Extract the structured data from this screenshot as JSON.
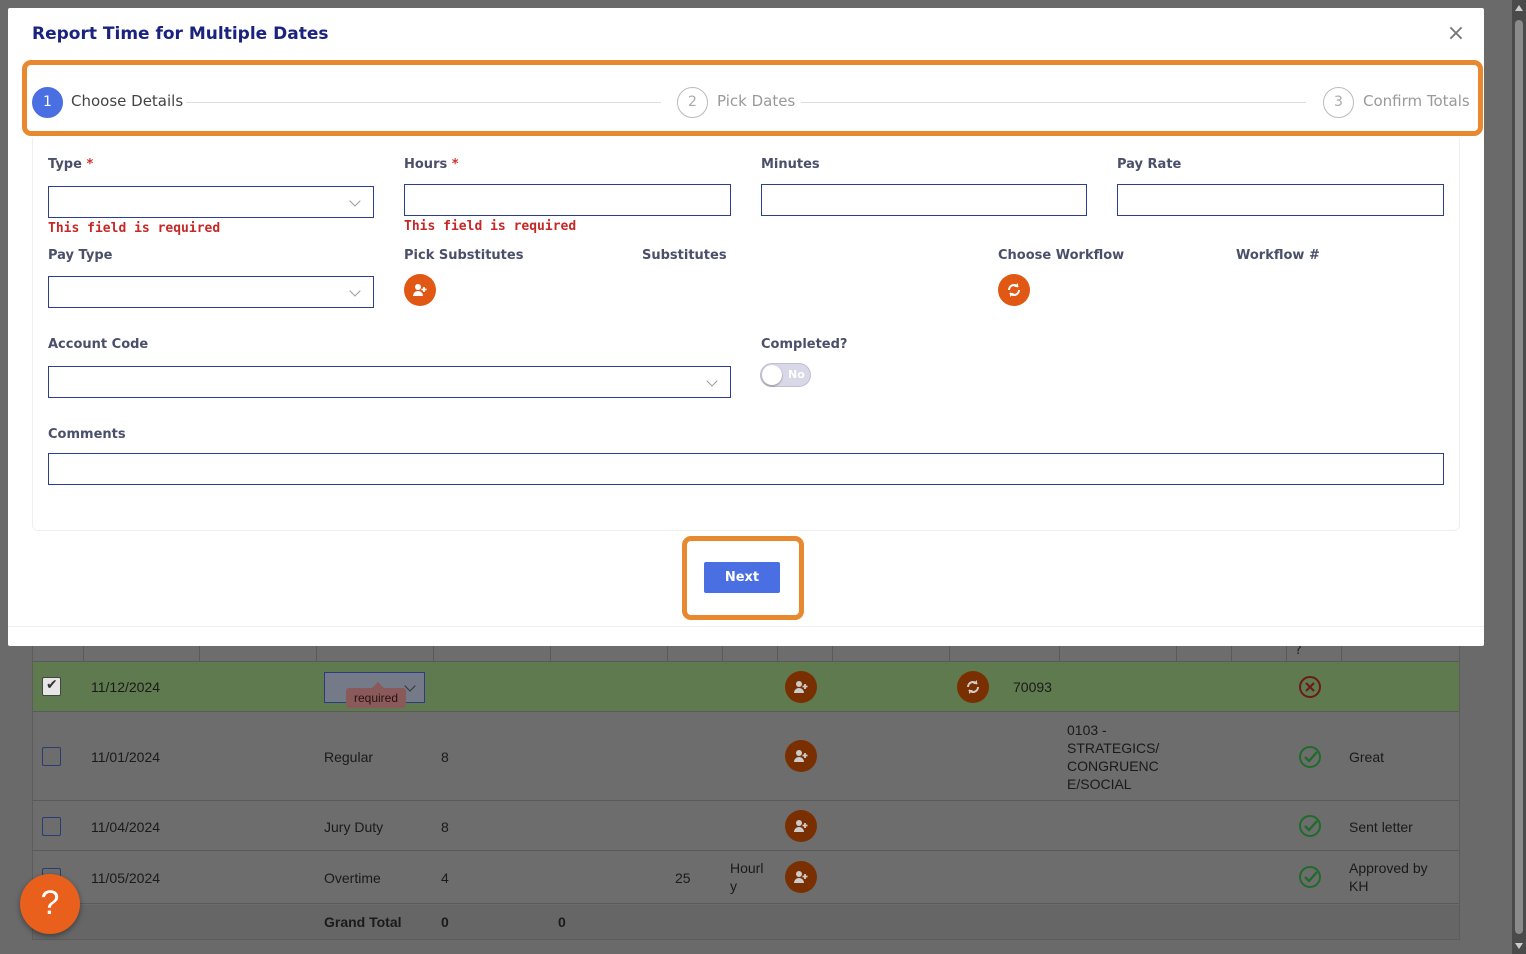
{
  "modal": {
    "title": "Report Time for Multiple Dates",
    "close_glyph": "×",
    "steps": [
      {
        "number": "1",
        "label": "Choose Details"
      },
      {
        "number": "2",
        "label": "Pick Dates"
      },
      {
        "number": "3",
        "label": "Confirm Totals"
      }
    ],
    "fields": {
      "type": {
        "label": "Type",
        "required_mark": "*",
        "value": "",
        "error": "This field is required"
      },
      "hours": {
        "label": "Hours",
        "required_mark": "*",
        "value": "",
        "error": "This field is required"
      },
      "minutes": {
        "label": "Minutes",
        "value": ""
      },
      "pay_rate": {
        "label": "Pay Rate",
        "value": ""
      },
      "pay_type": {
        "label": "Pay Type",
        "value": ""
      },
      "pick_substitutes": {
        "label": "Pick Substitutes"
      },
      "substitutes": {
        "label": "Substitutes"
      },
      "choose_workflow": {
        "label": "Choose Workflow"
      },
      "workflow_number": {
        "label": "Workflow #"
      },
      "account_code": {
        "label": "Account Code",
        "value": ""
      },
      "completed": {
        "label": "Completed?",
        "toggle_text": "No"
      },
      "comments": {
        "label": "Comments",
        "value": ""
      }
    },
    "next_label": "Next"
  },
  "background_table": {
    "header_fragment": "?",
    "rows": [
      {
        "date": "11/12/2024",
        "type": "",
        "tooltip": "required",
        "workflow": "70093",
        "status": "error",
        "checked": true
      },
      {
        "date": "11/01/2024",
        "type": "Regular",
        "hours": "8",
        "account": "0103 - STRATEGICS/ CONGRUENC E/SOCIAL",
        "account_lines": [
          "0103 -",
          "STRATEGICS/",
          "CONGRUENC",
          "E/SOCIAL"
        ],
        "status": "ok",
        "comment": "Great"
      },
      {
        "date": "11/04/2024",
        "type": "Jury Duty",
        "hours": "8",
        "status": "ok",
        "comment": "Sent letter"
      },
      {
        "date": "11/05/2024",
        "type": "Overtime",
        "hours": "4",
        "rate": "25",
        "pay_type_lines": [
          "Hourl",
          "y"
        ],
        "status": "ok",
        "comment_lines": [
          "Approved by",
          "KH"
        ]
      }
    ],
    "grand_total": {
      "label": "Grand Total",
      "hours": "0",
      "minutes": "0"
    }
  },
  "help_button": {
    "label": "?"
  },
  "colors": {
    "accent": "#4a6fe2",
    "highlight": "#e8892f",
    "action": "#e05814",
    "error": "#c62828",
    "title": "#1a237e"
  }
}
